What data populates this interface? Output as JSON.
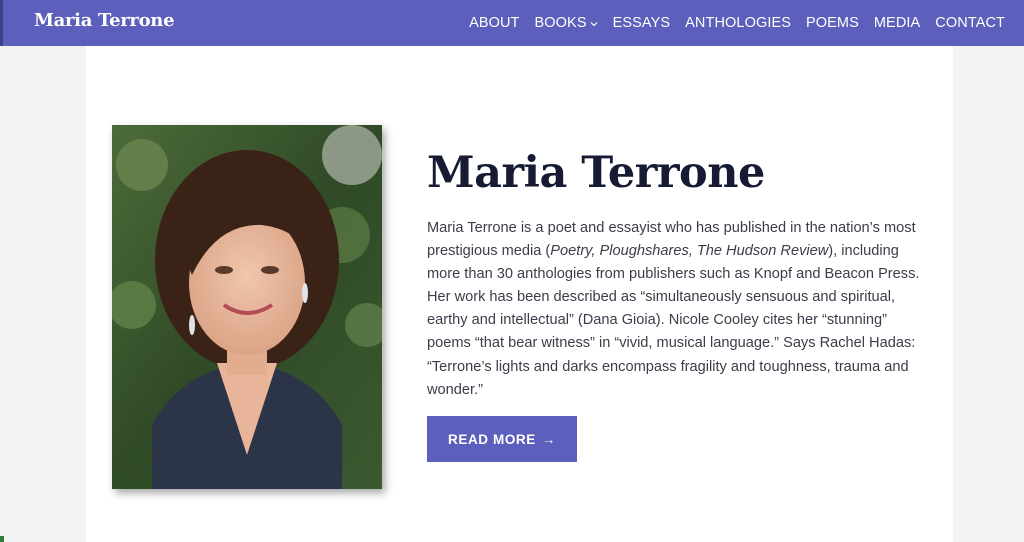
{
  "header": {
    "site_title": "Maria Terrone",
    "nav": [
      {
        "label": "ABOUT"
      },
      {
        "label": "BOOKS",
        "has_dropdown": true
      },
      {
        "label": "ESSAYS"
      },
      {
        "label": "ANTHOLOGIES"
      },
      {
        "label": "POEMS"
      },
      {
        "label": "MEDIA"
      },
      {
        "label": "CONTACT"
      }
    ]
  },
  "hero": {
    "heading": "Maria Terrone",
    "bio": {
      "p1": "Maria Terrone is a poet and essayist who has published in the nation’s most prestigious media (",
      "italic": "Poetry, Ploughshares, The Hudson Review",
      "p2": "), including more than 30 anthologies from publishers such as Knopf and Beacon Press. Her work has been described as “simultaneously sensuous and spiritual, earthy and intellectual” (Dana Gioia). Nicole Cooley cites her “stunning” poems “that bear witness” in “vivid, musical language.” Says Rachel Hadas: “Terrone’s lights and darks encompass fragility and toughness, trauma and wonder.”"
    },
    "cta_label": "READ MORE",
    "cta_arrow": "→"
  },
  "icons": {
    "dropdown": "chevron-down-icon",
    "cta": "arrow-right-icon"
  },
  "colors": {
    "brand": "#5c5fbb",
    "heading": "#161b33",
    "body_text": "#3b3d4a"
  }
}
